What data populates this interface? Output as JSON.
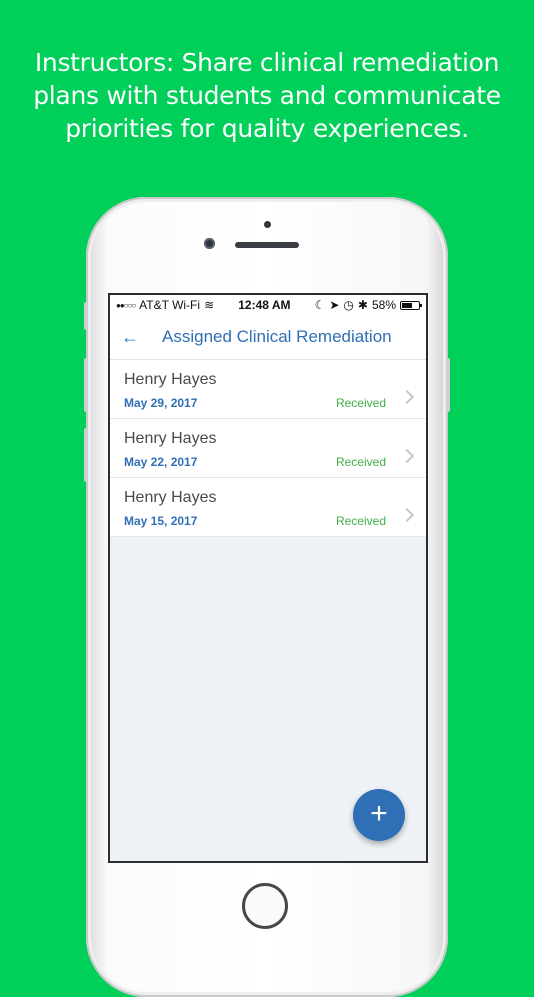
{
  "promo": {
    "lines": [
      "Instructors: Share clinical remediation",
      "plans with students and communicate",
      "priorities for quality experiences."
    ]
  },
  "status_bar": {
    "signal": "●●○○○",
    "carrier": "AT&T Wi-Fi",
    "time": "12:48 AM",
    "battery": "58%"
  },
  "nav": {
    "back_icon": "←",
    "title": "Assigned Clinical Remediation"
  },
  "remediations": [
    {
      "name": "Henry Hayes",
      "date": "May 29, 2017",
      "status": "Received"
    },
    {
      "name": "Henry Hayes",
      "date": "May 22, 2017",
      "status": "Received"
    },
    {
      "name": "Henry Hayes",
      "date": "May 15, 2017",
      "status": "Received"
    }
  ],
  "fab": {
    "icon": "+"
  },
  "colors": {
    "background": "#00cf5a",
    "accent": "#2f6fb5",
    "status_green": "#3fae49"
  }
}
